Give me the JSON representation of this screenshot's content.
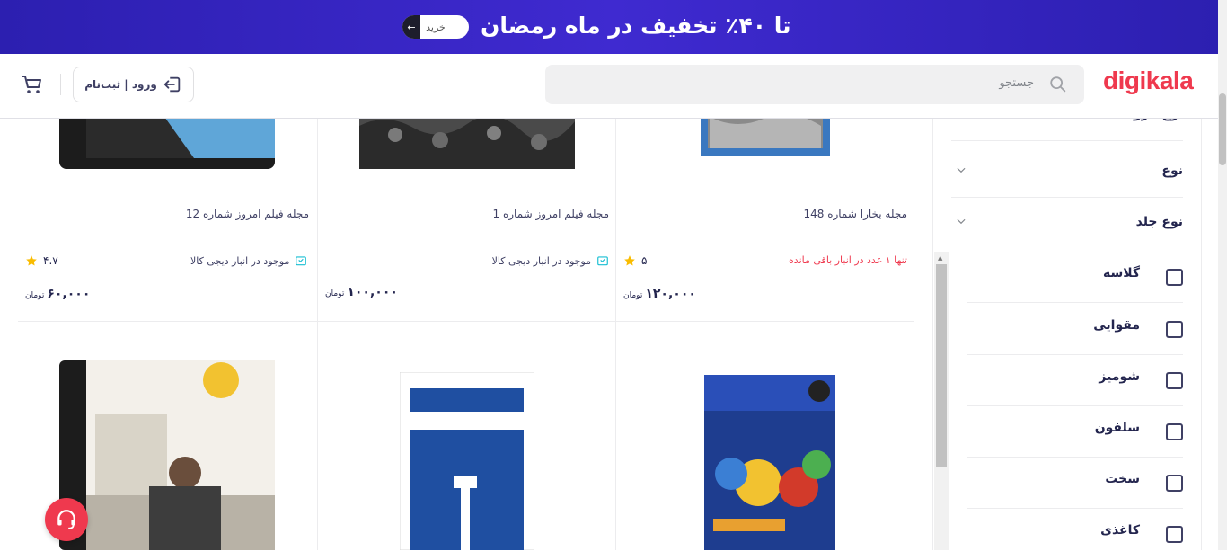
{
  "banner": {
    "text": "تا ۴۰٪ تخفیف در ماه رمضان",
    "buy_label": "خرید",
    "arrow": "←"
  },
  "header": {
    "logo": "digikala",
    "search_placeholder": "جستجو",
    "login_label": "ورود | ثبت‌نام"
  },
  "products": [
    {
      "title": "مجله بخارا شماره 148",
      "stock": "تنها ۱ عدد در انبار باقی مانده",
      "stock_type": "low",
      "rating": "۵",
      "price": "۱۲۰,۰۰۰",
      "currency": "تومان"
    },
    {
      "title": "مجله فیلم امروز شماره 1",
      "stock": "موجود در انبار دیجی کالا",
      "stock_type": "warehouse",
      "rating": "",
      "price": "۱۰۰,۰۰۰",
      "currency": "تومان"
    },
    {
      "title": "مجله فیلم امروز شماره 12",
      "stock": "موجود در انبار دیجی کالا",
      "stock_type": "warehouse",
      "rating": "۴.۷",
      "price": "۶۰,۰۰۰",
      "currency": "تومان"
    }
  ],
  "filters": {
    "collapsed": [
      "نوع فروشنده",
      "نوع",
      "نوع جلد"
    ],
    "cover_options": [
      "گلاسه",
      "مقوایی",
      "شومیز",
      "سلفون",
      "سخت",
      "کاغذی"
    ]
  },
  "colors": {
    "brand": "#ef394e",
    "banner": "#3f2ad0",
    "low_stock": "#ef394e",
    "warehouse_icon": "#19bfd3",
    "star": "#f9bc00"
  }
}
